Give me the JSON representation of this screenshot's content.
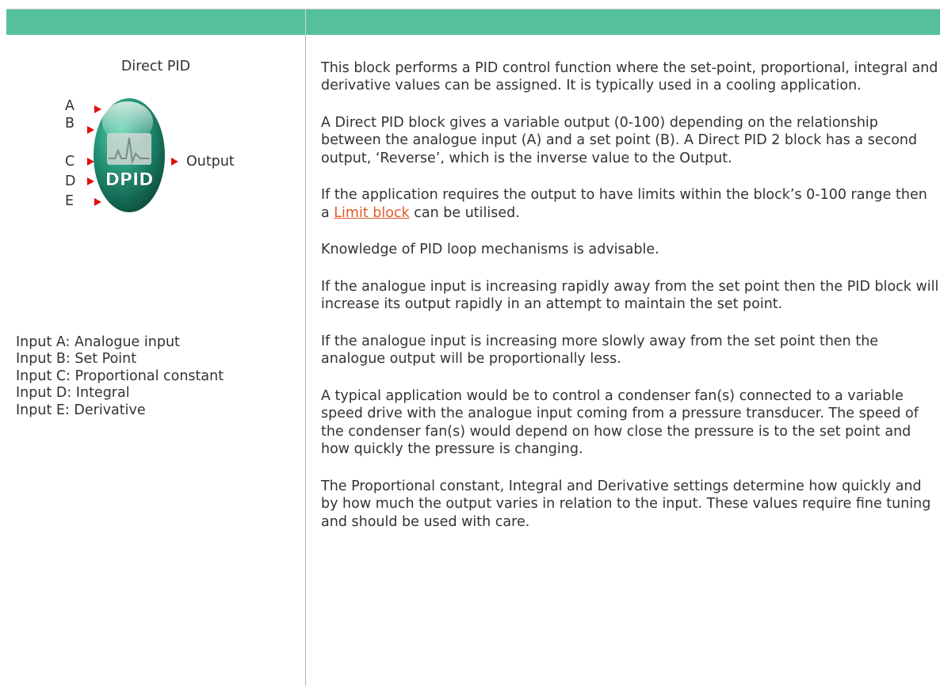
{
  "block": {
    "title": "Direct PID",
    "icon_label": "DPID",
    "output_label": "Output",
    "pins": [
      "A",
      "B",
      "C",
      "D",
      "E"
    ]
  },
  "inputs": [
    "Input A: Analogue input",
    "Input B: Set Point",
    "Input C: Proportional constant",
    "Input D: Integral",
    "Input E: Derivative"
  ],
  "description": {
    "p1": "This block performs a PID control function where the set-point, proportional, integral and derivative values can be assigned. It is typically used in a cooling application.",
    "p2": "A Direct PID block gives a variable output (0-100) depending on the relationship between the analogue input (A) and a set point (B). A Direct PID 2 block has a second output, ‘Reverse’, which is the inverse value to the Output.",
    "p3_before": "If the application requires the output to have limits within the block’s 0-100 range then a ",
    "p3_link": "Limit block",
    "p3_after": " can be utilised.",
    "p4": "Knowledge of PID loop mechanisms is advisable.",
    "p5": "If the analogue input is increasing rapidly away from the set point then the PID block will increase its output rapidly in an attempt to maintain the set point.",
    "p6": "If the analogue input is increasing more slowly away from the set point then the analogue output will be proportionally less.",
    "p7": "A typical application would be to control a condenser fan(s) connected to a variable speed drive with the analogue input coming from a pressure transducer. The speed of the condenser fan(s) would depend on how close the pressure is to the set point and how quickly the pressure is changing.",
    "p8": "The Proportional constant, Integral and Derivative settings determine how quickly and by how much the output varies in relation to the input. These values require fine tuning and should be used with care."
  },
  "colors": {
    "header": "#55c19b",
    "pin_arrow": "#e01010",
    "link": "#e05a2a",
    "icon_body": "#1f8a6e"
  }
}
